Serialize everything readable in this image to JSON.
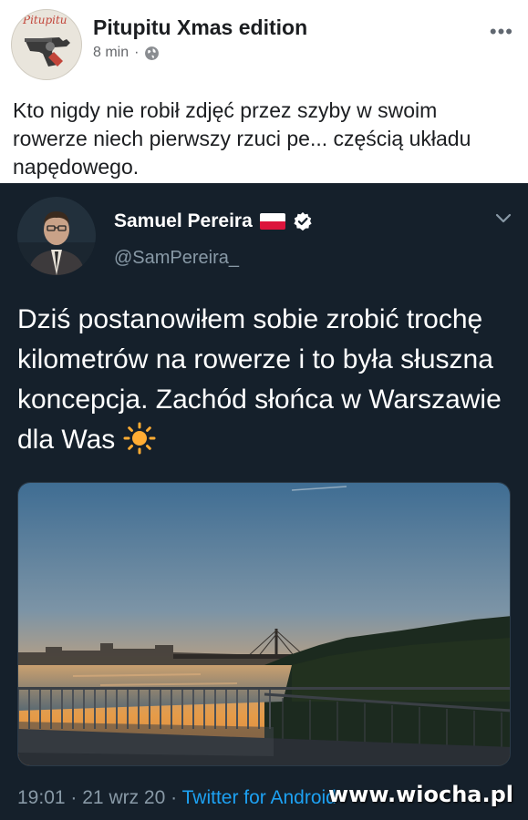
{
  "post": {
    "page_name": "Pitupitu Xmas edition",
    "avatar_text": "Pitupitu",
    "time": "8 min",
    "separator": "·",
    "more": "•••",
    "text": "Kto nigdy nie robił zdjęć przez szyby w swoim rowerze niech pierwszy rzuci pe...  częścią układu napędowego."
  },
  "tweet": {
    "author": "Samuel Pereira",
    "handle": "@SamPereira_",
    "text": "Dziś postanowiłem sobie zrobić trochę kilometrów na rowerze i to była słuszna koncepcja. Zachód słońca w Warszawie dla Was",
    "time": "19:01",
    "date": "21 wrz 20",
    "separator": "·",
    "source": "Twitter for Android"
  },
  "colors": {
    "tweet_bg": "#15202b",
    "link_blue": "#1da1f2",
    "muted": "#8899a6"
  },
  "watermark": "www.wiocha.pl"
}
